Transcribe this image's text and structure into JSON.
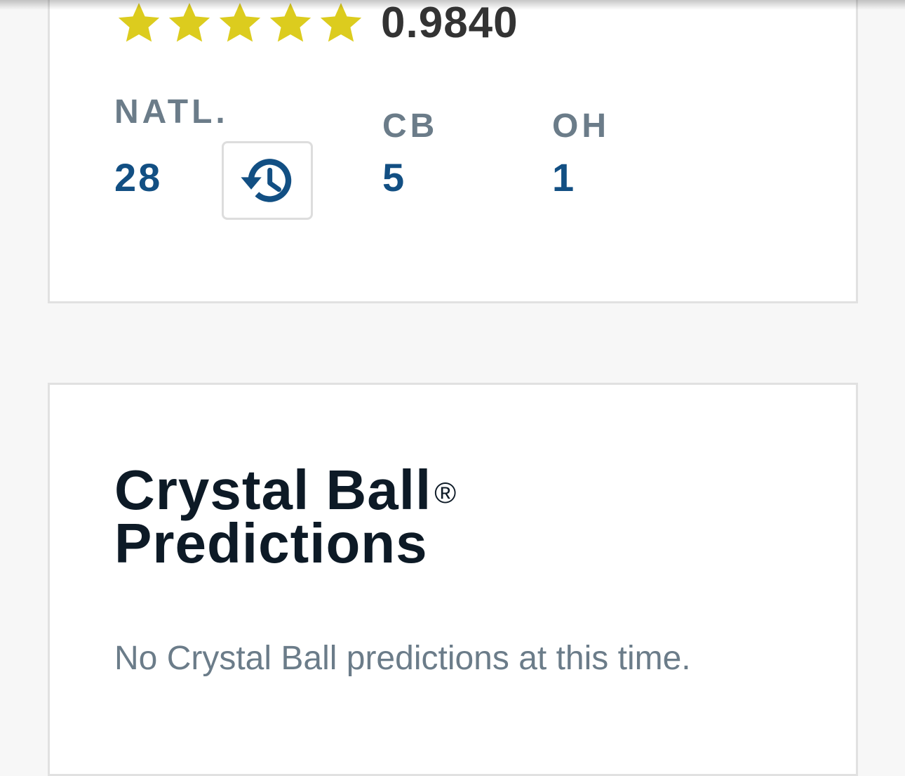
{
  "colors": {
    "star": "#dccc1e",
    "rank_value": "#124f83",
    "label": "#6b7c89",
    "heading": "#0d1a26",
    "rating": "#333333",
    "page_bg": "#f7f7f7"
  },
  "rating": {
    "stars": 5,
    "stars_max": 5,
    "value": "0.9840"
  },
  "rankings": {
    "national": {
      "label": "NATL.",
      "value": "28"
    },
    "position": {
      "label": "CB",
      "value": "5"
    },
    "state": {
      "label": "OH",
      "value": "1"
    },
    "history_icon": "history-clock-icon"
  },
  "predictions": {
    "title_line1": "Crystal Ball",
    "trademark": "®",
    "title_line2": "Predictions",
    "empty_message": "No Crystal Ball predictions at this time."
  }
}
